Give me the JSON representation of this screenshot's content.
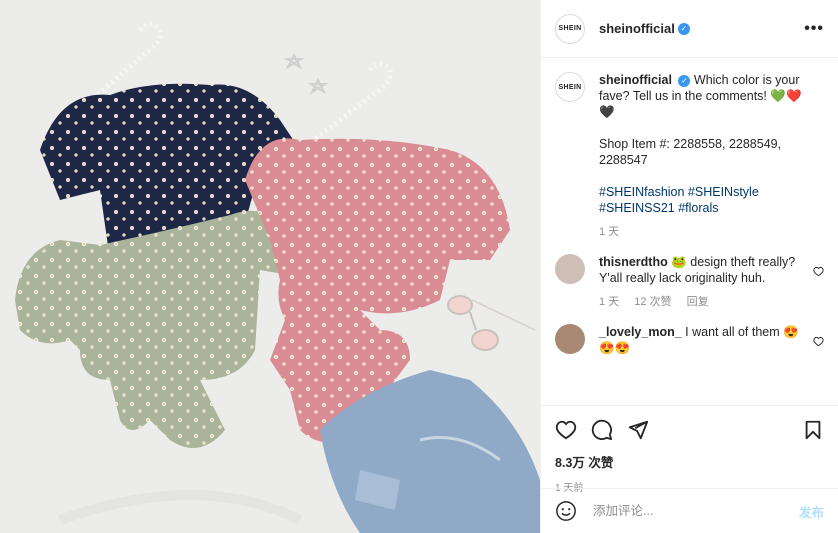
{
  "header": {
    "avatar_text": "SHEIN",
    "username": "sheinofficial",
    "more_label": "•••"
  },
  "caption": {
    "username": "sheinofficial",
    "text": "Which color is your fave? Tell us in the comments! 💚❤️🖤",
    "shop_items": "Shop Item #: 2288558, 2288549, 2288547",
    "hashtags": "#SHEINfashion #SHEINstyle #SHEINSS21 #florals",
    "time": "1 天"
  },
  "comments": [
    {
      "username": "thisnerdtho",
      "text": "🐸 design theft really? Y'all really lack originality huh.",
      "time": "1 天",
      "likes": "12 次赞",
      "reply": "回复"
    },
    {
      "username": "_lovely_mon_",
      "text": "I want all of them 😍😍😍"
    }
  ],
  "footer": {
    "likes": "8.3万 次赞",
    "time": "1 天前",
    "comment_placeholder": "添加评论...",
    "post_label": "发布"
  },
  "colors": {
    "accent": "#3897f0",
    "post_disabled": "#b2dffc",
    "hashtag": "#00376b"
  }
}
